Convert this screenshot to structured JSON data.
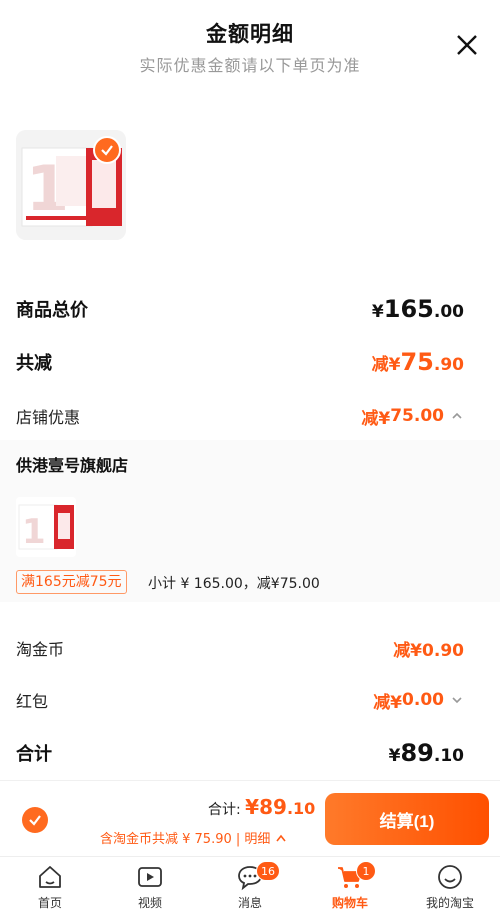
{
  "header": {
    "title": "金额明细",
    "subtitle": "实际优惠金额请以下单页为准"
  },
  "summary": {
    "goods_total_label": "商品总价",
    "goods_total_yen": "¥",
    "goods_total_int": "165",
    "goods_total_dec": ".00",
    "total_reduce_label": "共减",
    "total_reduce_prefix": "减¥",
    "total_reduce_int": "75",
    "total_reduce_dec": ".90",
    "store_discount_label": "店铺优惠",
    "store_discount_prefix": "减¥",
    "store_discount_int": "75",
    "store_discount_dec": ".00"
  },
  "shop": {
    "name": "供港壹号旗舰店",
    "promo_tag": "满165元减75元",
    "subtotal": "小计 ¥ 165.00，减¥75.00"
  },
  "extras": {
    "coins_label": "淘金币",
    "coins_prefix": "减¥",
    "coins_int": "0",
    "coins_dec": ".90",
    "redpacket_label": "红包",
    "redpacket_prefix": "减¥",
    "redpacket_int": "0",
    "redpacket_dec": ".00",
    "total_label": "合计",
    "total_yen": "¥",
    "total_int": "89",
    "total_dec": ".10"
  },
  "bottom": {
    "total_prefix": "合计: ",
    "total_yen": "¥",
    "total_int": "89",
    "total_dec": ".10",
    "discount_line": "含淘金币共减 ¥ 75.90 | 明细",
    "checkout_label": "结算(1)"
  },
  "tabs": [
    {
      "label": "首页",
      "icon": "home-icon"
    },
    {
      "label": "视频",
      "icon": "video-icon"
    },
    {
      "label": "消息",
      "icon": "message-icon",
      "badge": "16"
    },
    {
      "label": "购物车",
      "icon": "cart-icon",
      "badge": "1"
    },
    {
      "label": "我的淘宝",
      "icon": "profile-icon"
    }
  ],
  "colors": {
    "accent": "#ff5a14",
    "accent_btn": "#ff6a1f"
  }
}
